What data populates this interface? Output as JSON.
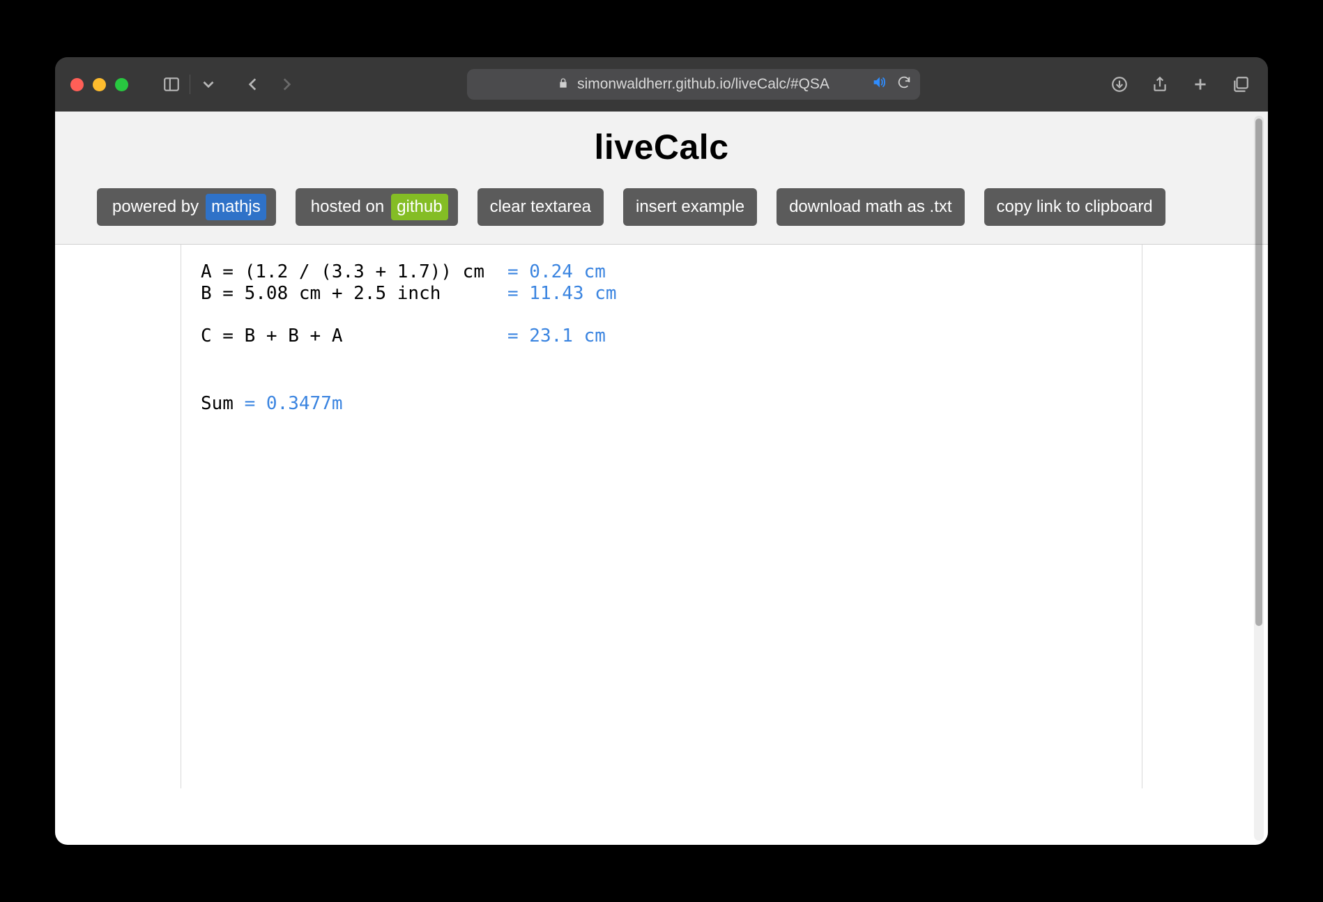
{
  "browser": {
    "url_display": "simonwaldherr.github.io/liveCalc/#QSA"
  },
  "page": {
    "title": "liveCalc",
    "buttons": {
      "powered_prefix": "powered by",
      "powered_badge": "mathjs",
      "hosted_prefix": "hosted on",
      "hosted_badge": "github",
      "clear": "clear  textarea",
      "insert": "insert  example",
      "download": "download math  as .txt",
      "copylink": "copy link  to clipboard"
    },
    "editor_lines": [
      {
        "expr": "A = (1.2 / (3.3 + 1.7)) cm",
        "res": "= 0.24 cm"
      },
      {
        "expr": "B = 5.08 cm + 2.5 inch",
        "res": "= 11.43 cm"
      },
      {
        "gap": true
      },
      {
        "expr": "C = B + B + A",
        "res": "= 23.1 cm"
      },
      {
        "big_gap": true
      },
      {
        "inline_expr": "Sum",
        "inline_res": " = 0.3477m"
      }
    ]
  }
}
